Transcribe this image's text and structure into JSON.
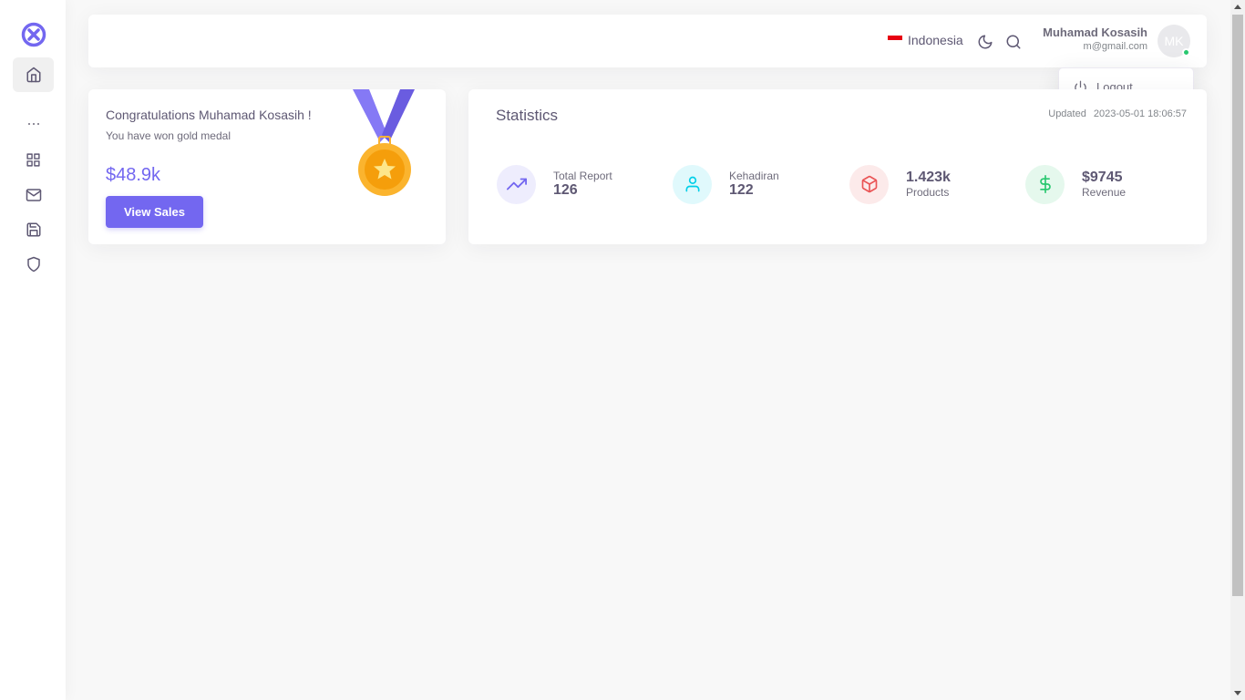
{
  "sidebar": {
    "logo_icon": "close-circle-logo",
    "items": [
      {
        "icon": "home-icon",
        "active": true
      },
      {
        "icon": "more-horizontal-icon"
      },
      {
        "icon": "grid-icon"
      },
      {
        "icon": "mail-icon"
      },
      {
        "icon": "save-icon"
      },
      {
        "icon": "shield-icon"
      }
    ]
  },
  "navbar": {
    "language": "Indonesia",
    "user_name": "Muhamad Kosasih",
    "user_email": "m@gmail.com",
    "avatar_initials": "MK"
  },
  "dropdown": {
    "logout_label": "Logout"
  },
  "congrats": {
    "title": "Congratulations Muhamad Kosasih !",
    "subtitle": "You have won gold medal",
    "amount": "$48.9k",
    "button_label": "View Sales"
  },
  "statistics": {
    "title": "Statistics",
    "updated_label": "Updated",
    "updated_time": "2023-05-01 18:06:57",
    "items": [
      {
        "label": "Total Report",
        "value": "126",
        "icon": "trending-up-icon",
        "color": "#7367f0",
        "bg": "#eeedfd"
      },
      {
        "label": "Kehadiran",
        "value": "122",
        "icon": "user-icon",
        "color": "#00cfe8",
        "bg": "#e0f9fc"
      },
      {
        "label": "Products",
        "value": "1.423k",
        "icon": "box-icon",
        "color": "#ea5455",
        "bg": "#fceaea"
      },
      {
        "label": "Revenue",
        "value": "$9745",
        "icon": "dollar-sign-icon",
        "color": "#28c76f",
        "bg": "#e5f8ed"
      }
    ]
  },
  "colors": {
    "primary": "#7367f0",
    "background": "#f8f8f8",
    "status_online": "#28c76f"
  }
}
